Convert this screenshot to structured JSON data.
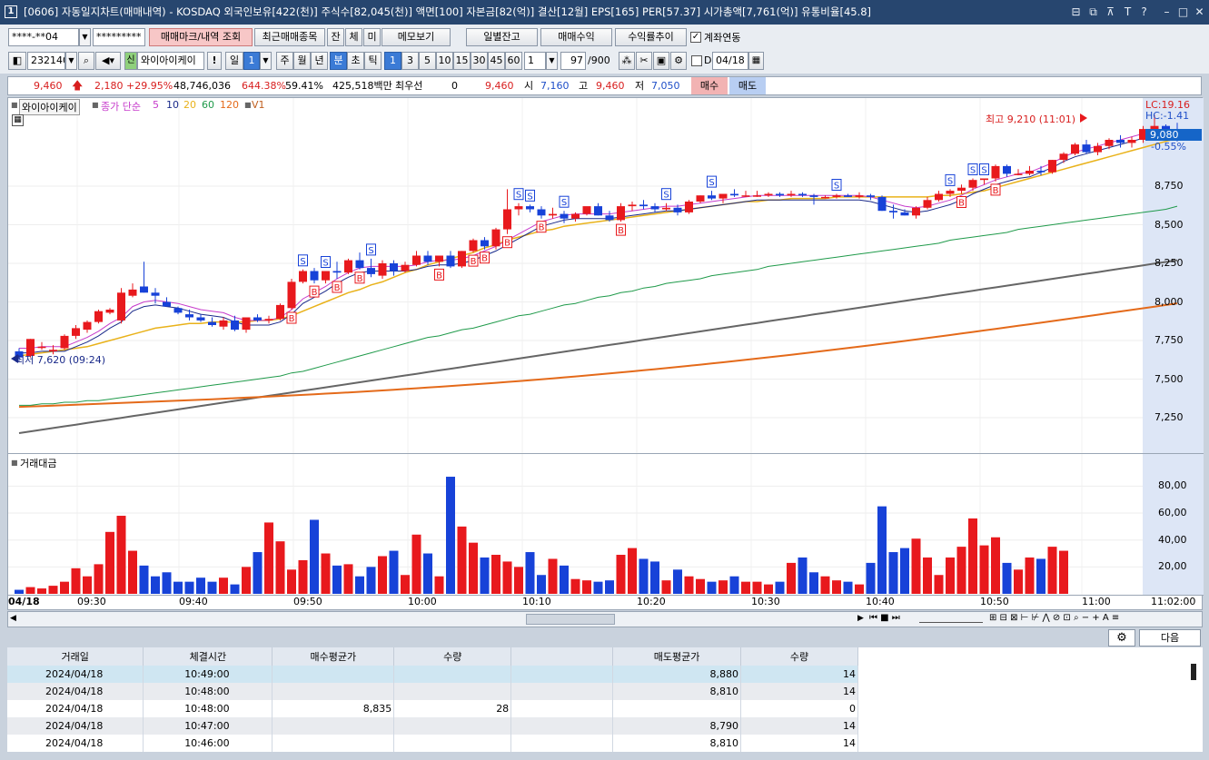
{
  "titlebar": {
    "icon": "1",
    "title": "[0606] 자동일지차트(매매내역) - KOSDAQ 외국인보유[422(천)] 주식수[82,045(천)] 액면[100] 자본금[82(억)] 결산[12월] EPS[165] PER[57.37] 시가총액[7,761(억)] 유통비율[45.8]",
    "buttons": [
      "⊟",
      "⧉",
      "⊼",
      "T",
      "?",
      "–",
      "□",
      "✕"
    ]
  },
  "toolbar1": {
    "account": "****-**04",
    "password": "*********",
    "btn_mark": "매매마크/내역 조회",
    "btn_recent": "최근매매종목",
    "btn_jan": "잔",
    "btn_che": "체",
    "btn_mi": "미",
    "btn_memo": "메모보기",
    "btn_daily": "일별잔고",
    "btn_profit": "매매수익",
    "btn_rate": "수익률추이",
    "chk_account": "계좌연동"
  },
  "toolbar2": {
    "code": "232140",
    "sin": "신",
    "name": "와이아이케이",
    "excl": "!",
    "period_il": "일",
    "period_num": "1",
    "ju": "주",
    "wol": "월",
    "nyeon": "년",
    "bun": "분",
    "cho": "초",
    "tik": "틱",
    "intervals": [
      "1",
      "3",
      "5",
      "10",
      "15",
      "30",
      "45",
      "60"
    ],
    "selected_interval": "1",
    "cnt": "1",
    "count": "97",
    "total": "/900",
    "d_label": "D",
    "date": "04/18"
  },
  "quote": {
    "price": "9,460",
    "change": "2,180",
    "pct": "+29.95%",
    "volume": "48,746,036",
    "vol_rate": "644.38%",
    "turnover": "59.41%",
    "amount": "425,518백만",
    "priority": "최우선",
    "priority_val": "0",
    "ask": "9,460",
    "open_lbl": "시",
    "open": "7,160",
    "high_lbl": "고",
    "high": "9,460",
    "low_lbl": "저",
    "low": "7,050",
    "buy": "매수",
    "sell": "매도"
  },
  "chart_legend": {
    "stock": "와이아이케이",
    "ma_title": "종가 단순",
    "ma": [
      "5",
      "10",
      "20",
      "60",
      "120"
    ],
    "vol": "V1",
    "volume_title": "거래대금"
  },
  "chart_labels": {
    "lc": "LC:19.16",
    "hc": "HC:-1.41",
    "cur": "9,080",
    "cur_pct": "-0.55%",
    "hi_note": "최고 9,210 (11:01)",
    "lo_note": "최저 7,620 (09:24)"
  },
  "price_axis": [
    "8,750",
    "8,500",
    "8,250",
    "8,000",
    "7,750",
    "7,500",
    "7,250"
  ],
  "vol_axis": [
    "80,00",
    "60,00",
    "40,00",
    "20,00"
  ],
  "time_axis": [
    "04/18",
    "09:30",
    "09:40",
    "09:50",
    "10:00",
    "10:10",
    "10:20",
    "10:30",
    "10:40",
    "10:50",
    "11:00",
    "11:02:00"
  ],
  "colors": {
    "up": "#e8191d",
    "down": "#1742d8",
    "ma5": "#c63bcb",
    "ma10": "#1a2a8a",
    "ma20": "#e9b21a",
    "ma60": "#1f9a4a",
    "ma120": "#e46a1a",
    "ma240": "#666666"
  },
  "chart_data": {
    "type": "candlestick+volume",
    "ylim": [
      7100,
      9260
    ],
    "ohlc": [
      [
        7680,
        7700,
        7620,
        7640
      ],
      [
        7650,
        7760,
        7640,
        7760
      ],
      [
        7710,
        7740,
        7690,
        7710
      ],
      [
        7680,
        7720,
        7660,
        7690
      ],
      [
        7700,
        7790,
        7690,
        7780
      ],
      [
        7780,
        7850,
        7760,
        7830
      ],
      [
        7820,
        7880,
        7800,
        7870
      ],
      [
        7870,
        7950,
        7860,
        7940
      ],
      [
        7930,
        7960,
        7920,
        7950
      ],
      [
        7880,
        8090,
        7860,
        8060
      ],
      [
        8040,
        8120,
        8030,
        8080
      ],
      [
        8100,
        8260,
        8060,
        8060
      ],
      [
        8060,
        8090,
        7990,
        8040
      ],
      [
        8000,
        8030,
        7970,
        7970
      ],
      [
        7960,
        7970,
        7920,
        7930
      ],
      [
        7920,
        7950,
        7880,
        7900
      ],
      [
        7900,
        7920,
        7870,
        7880
      ],
      [
        7870,
        7900,
        7840,
        7850
      ],
      [
        7840,
        7900,
        7820,
        7880
      ],
      [
        7880,
        7910,
        7810,
        7820
      ],
      [
        7820,
        7900,
        7800,
        7900
      ],
      [
        7900,
        7920,
        7870,
        7880
      ],
      [
        7880,
        7910,
        7860,
        7890
      ],
      [
        7890,
        7990,
        7880,
        7980
      ],
      [
        7960,
        8150,
        7950,
        8130
      ],
      [
        8130,
        8210,
        8120,
        8200
      ],
      [
        8200,
        8220,
        8120,
        8140
      ],
      [
        8140,
        8200,
        8120,
        8200
      ],
      [
        8200,
        8260,
        8150,
        8190
      ],
      [
        8190,
        8280,
        8180,
        8270
      ],
      [
        8270,
        8320,
        8210,
        8220
      ],
      [
        8220,
        8280,
        8160,
        8180
      ],
      [
        8170,
        8270,
        8150,
        8250
      ],
      [
        8250,
        8270,
        8170,
        8200
      ],
      [
        8200,
        8260,
        8190,
        8240
      ],
      [
        8240,
        8330,
        8230,
        8300
      ],
      [
        8300,
        8330,
        8240,
        8260
      ],
      [
        8260,
        8300,
        8230,
        8300
      ],
      [
        8300,
        8330,
        8220,
        8230
      ],
      [
        8230,
        8330,
        8220,
        8330
      ],
      [
        8330,
        8410,
        8320,
        8400
      ],
      [
        8400,
        8420,
        8340,
        8360
      ],
      [
        8360,
        8480,
        8340,
        8470
      ],
      [
        8470,
        8730,
        8440,
        8600
      ],
      [
        8600,
        8640,
        8560,
        8620
      ],
      [
        8620,
        8630,
        8580,
        8600
      ],
      [
        8600,
        8620,
        8540,
        8560
      ],
      [
        8560,
        8610,
        8540,
        8570
      ],
      [
        8570,
        8590,
        8510,
        8540
      ],
      [
        8540,
        8580,
        8520,
        8570
      ],
      [
        8570,
        8610,
        8560,
        8620
      ],
      [
        8620,
        8640,
        8560,
        8560
      ],
      [
        8560,
        8590,
        8520,
        8530
      ],
      [
        8530,
        8640,
        8520,
        8620
      ],
      [
        8620,
        8650,
        8590,
        8630
      ],
      [
        8630,
        8660,
        8600,
        8620
      ],
      [
        8620,
        8640,
        8580,
        8600
      ],
      [
        8600,
        8640,
        8590,
        8610
      ],
      [
        8610,
        8630,
        8560,
        8580
      ],
      [
        8580,
        8660,
        8570,
        8650
      ],
      [
        8650,
        8690,
        8640,
        8690
      ],
      [
        8690,
        8720,
        8660,
        8670
      ],
      [
        8670,
        8700,
        8640,
        8700
      ],
      [
        8700,
        8730,
        8680,
        8690
      ],
      [
        8690,
        8720,
        8680,
        8690
      ],
      [
        8690,
        8720,
        8680,
        8690
      ],
      [
        8690,
        8710,
        8680,
        8700
      ],
      [
        8700,
        8710,
        8680,
        8690
      ],
      [
        8690,
        8720,
        8680,
        8700
      ],
      [
        8700,
        8710,
        8680,
        8690
      ],
      [
        8690,
        8700,
        8630,
        8680
      ],
      [
        8680,
        8690,
        8670,
        8680
      ],
      [
        8680,
        8700,
        8670,
        8690
      ],
      [
        8690,
        8700,
        8680,
        8680
      ],
      [
        8680,
        8710,
        8670,
        8690
      ],
      [
        8690,
        8700,
        8660,
        8680
      ],
      [
        8680,
        8690,
        8590,
        8590
      ],
      [
        8590,
        8630,
        8540,
        8580
      ],
      [
        8580,
        8600,
        8560,
        8560
      ],
      [
        8560,
        8620,
        8540,
        8610
      ],
      [
        8610,
        8680,
        8600,
        8660
      ],
      [
        8660,
        8720,
        8650,
        8700
      ],
      [
        8700,
        8730,
        8680,
        8720
      ],
      [
        8720,
        8760,
        8700,
        8740
      ],
      [
        8740,
        8800,
        8720,
        8790
      ],
      [
        8790,
        8800,
        8760,
        8800
      ],
      [
        8800,
        8890,
        8780,
        8880
      ],
      [
        8880,
        8890,
        8810,
        8830
      ],
      [
        8830,
        8860,
        8820,
        8830
      ],
      [
        8830,
        8880,
        8820,
        8850
      ],
      [
        8850,
        8880,
        8820,
        8840
      ],
      [
        8840,
        8920,
        8830,
        8920
      ],
      [
        8920,
        8970,
        8900,
        8960
      ],
      [
        8960,
        9030,
        8950,
        9020
      ],
      [
        9020,
        9050,
        8960,
        8970
      ],
      [
        8970,
        9030,
        8950,
        9010
      ],
      [
        9010,
        9060,
        8990,
        9050
      ],
      [
        9050,
        9080,
        9000,
        9030
      ],
      [
        9030,
        9070,
        9000,
        9050
      ],
      [
        9050,
        9140,
        9030,
        9120
      ],
      [
        9120,
        9210,
        9090,
        9140
      ],
      [
        9140,
        9150,
        9080,
        9110
      ],
      [
        9110,
        9160,
        9040,
        9080
      ]
    ],
    "volume": [
      3,
      5,
      4,
      6,
      9,
      19,
      13,
      22,
      46,
      58,
      32,
      21,
      13,
      16,
      9,
      9,
      12,
      9,
      12,
      7,
      20,
      31,
      53,
      39,
      18,
      25,
      55,
      30,
      21,
      22,
      13,
      20,
      28,
      32,
      14,
      44,
      30,
      13,
      87,
      50,
      38,
      27,
      29,
      24,
      20,
      31,
      14,
      26,
      21,
      11,
      10,
      9,
      10,
      29,
      34,
      26,
      24,
      10,
      18,
      13,
      11,
      9,
      10,
      13,
      9,
      9,
      7,
      9,
      23,
      27,
      16,
      13,
      10,
      9,
      7,
      23,
      65,
      31,
      34,
      41,
      27,
      14,
      27,
      35,
      56,
      36,
      42,
      23,
      18,
      27,
      26,
      35,
      32
    ],
    "ma5": [
      7700,
      7700,
      7710,
      7710,
      7710,
      7740,
      7770,
      7810,
      7860,
      7900,
      7970,
      8000,
      8010,
      8000,
      7990,
      7970,
      7950,
      7940,
      7930,
      7900,
      7880,
      7880,
      7880,
      7900,
      7950,
      8020,
      8060,
      8100,
      8150,
      8190,
      8220,
      8230,
      8230,
      8230,
      8230,
      8240,
      8260,
      8270,
      8270,
      8280,
      8300,
      8330,
      8360,
      8400,
      8440,
      8480,
      8520,
      8540,
      8560,
      8570,
      8570,
      8570,
      8570,
      8580,
      8590,
      8600,
      8610,
      8620,
      8620,
      8630,
      8640,
      8650,
      8660,
      8670,
      8680,
      8690,
      8690,
      8690,
      8690,
      8690,
      8690,
      8690,
      8690,
      8690,
      8690,
      8680,
      8660,
      8640,
      8620,
      8610,
      8620,
      8640,
      8660,
      8690,
      8730,
      8760,
      8790,
      8810,
      8830,
      8840,
      8870,
      8900,
      8940,
      8970,
      8990,
      9010,
      9030,
      9050,
      9070,
      9090,
      9100,
      9100,
      9100
    ],
    "ma20": [
      7650,
      7660,
      7670,
      7680,
      7690,
      7700,
      7710,
      7730,
      7750,
      7770,
      7790,
      7810,
      7830,
      7840,
      7850,
      7860,
      7860,
      7870,
      7870,
      7870,
      7870,
      7880,
      7880,
      7890,
      7910,
      7940,
      7970,
      8000,
      8030,
      8060,
      8080,
      8110,
      8130,
      8160,
      8190,
      8210,
      8240,
      8260,
      8280,
      8300,
      8320,
      8350,
      8370,
      8400,
      8420,
      8440,
      8460,
      8470,
      8490,
      8500,
      8510,
      8520,
      8530,
      8540,
      8550,
      8560,
      8570,
      8580,
      8590,
      8600,
      8610,
      8620,
      8630,
      8640,
      8650,
      8650,
      8660,
      8660,
      8670,
      8670,
      8670,
      8670,
      8680,
      8680,
      8680,
      8680,
      8680,
      8680,
      8680,
      8680,
      8680,
      8690,
      8690,
      8700,
      8710,
      8720,
      8740,
      8760,
      8780,
      8800,
      8820,
      8840,
      8860,
      8880,
      8900,
      8920,
      8940,
      8960,
      8980,
      9000,
      9020,
      9040,
      9060
    ],
    "ma60": [
      7500,
      7500,
      7510,
      7510,
      7520,
      7520,
      7530,
      7530,
      7540,
      7550,
      7560,
      7570,
      7580,
      7590,
      7600,
      7610,
      7620,
      7630,
      7640,
      7650,
      7660,
      7670,
      7680,
      7690,
      7710,
      7720,
      7740,
      7760,
      7780,
      7800,
      7820,
      7840,
      7860,
      7880,
      7900,
      7920,
      7940,
      7950,
      7970,
      7990,
      8000,
      8020,
      8040,
      8060,
      8080,
      8090,
      8110,
      8130,
      8150,
      8160,
      8180,
      8200,
      8210,
      8230,
      8240,
      8260,
      8270,
      8290,
      8300,
      8310,
      8320,
      8340,
      8350,
      8360,
      8370,
      8380,
      8400,
      8410,
      8420,
      8430,
      8440,
      8450,
      8460,
      8470,
      8480,
      8490,
      8500,
      8510,
      8520,
      8530,
      8540,
      8550,
      8570,
      8580,
      8590,
      8600,
      8610,
      8620,
      8640,
      8650,
      8660,
      8670,
      8680,
      8690,
      8700,
      8710,
      8720,
      8730,
      8740,
      8750,
      8760,
      8770,
      8790
    ]
  },
  "grid": {
    "headers": [
      "거래일",
      "체결시간",
      "매수평균가",
      "수량",
      "",
      "매도평균가",
      "수량"
    ],
    "rows": [
      [
        "2024/04/18",
        "10:49:00",
        "",
        "",
        "",
        "8,880",
        "14"
      ],
      [
        "2024/04/18",
        "10:48:00",
        "",
        "",
        "",
        "8,810",
        "14"
      ],
      [
        "2024/04/18",
        "10:48:00",
        "8,835",
        "28",
        "",
        "",
        "0"
      ],
      [
        "2024/04/18",
        "10:47:00",
        "",
        "",
        "",
        "8,790",
        "14"
      ],
      [
        "2024/04/18",
        "10:46:00",
        "",
        "",
        "",
        "8,810",
        "14"
      ]
    ],
    "next_btn": "다음"
  }
}
